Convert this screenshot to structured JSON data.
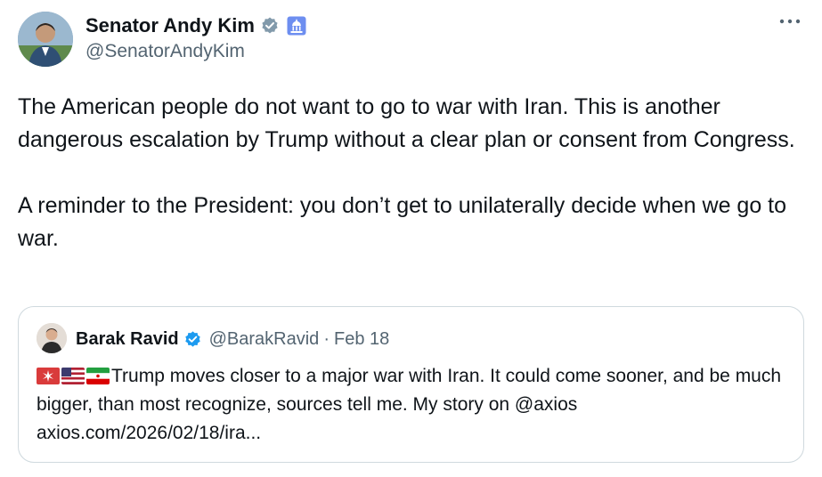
{
  "author": {
    "display_name": "Senator Andy Kim",
    "handle": "@SenatorAndyKim",
    "verified_icon": "verified-badge-icon",
    "affiliation_icon": "government-building-badge-icon",
    "avatar_icon": "profile-photo-avatar"
  },
  "menu": {
    "more_icon": "more-options-icon"
  },
  "post": {
    "paragraph_1": "The American people do not want to go to war with Iran. This is another dangerous escalation by Trump without a clear plan or consent from Congress.",
    "paragraph_2": "A reminder to the President: you don’t get to unilaterally decide when we go to war."
  },
  "quote": {
    "display_name": "Barak Ravid",
    "handle": "@BarakRavid",
    "separator": "·",
    "date": "Feb 18",
    "flags": [
      "bangbar-emoji-icon",
      "us-flag-icon",
      "iran-flag-icon"
    ],
    "line_1": "Trump moves closer to a major war with Iran. It could come sooner, and be much bigger, than most recognize, sources tell me. My story on @axios",
    "link": "axios.com/2026/02/18/ira..."
  },
  "colors": {
    "text_primary": "#0f1419",
    "text_secondary": "#536471",
    "border": "#cfd9de",
    "verified_blue": "#1d9bf0",
    "verified_gray": "#829aab"
  }
}
